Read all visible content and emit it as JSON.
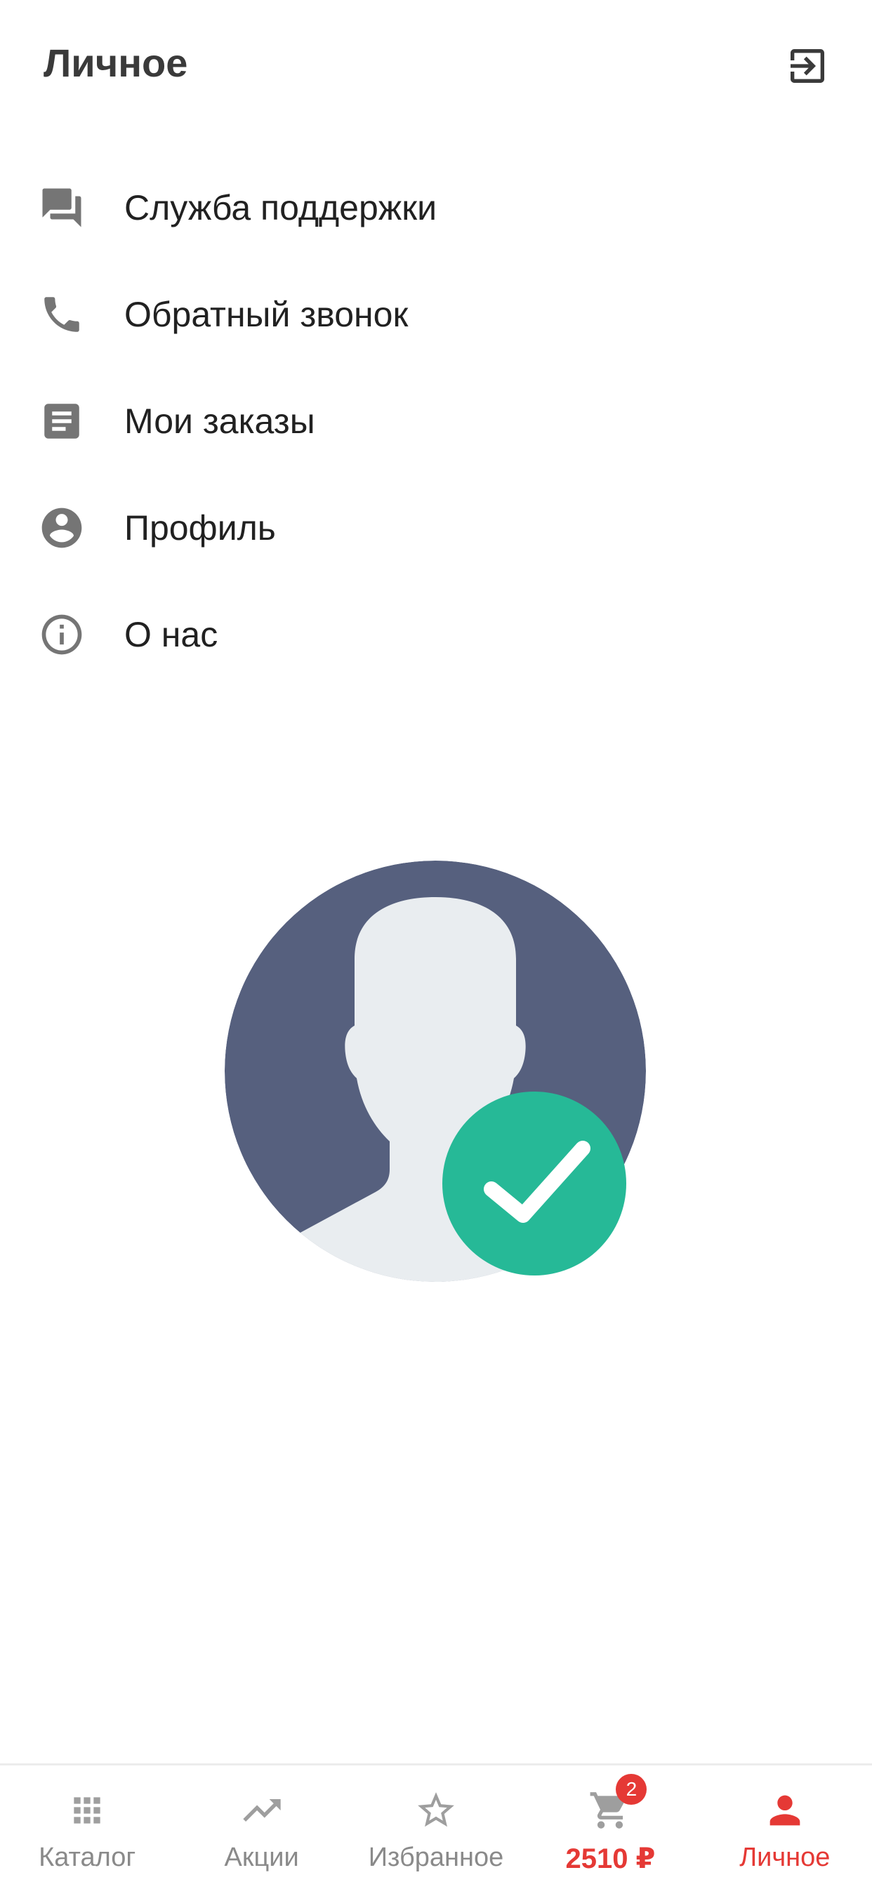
{
  "header": {
    "title": "Личное",
    "logout_icon": "logout-icon"
  },
  "menu": {
    "items": [
      {
        "label": "Служба поддержки",
        "icon": "chat-icon"
      },
      {
        "label": "Обратный звонок",
        "icon": "phone-icon"
      },
      {
        "label": "Мои заказы",
        "icon": "orders-icon"
      },
      {
        "label": "Профиль",
        "icon": "account-icon"
      },
      {
        "label": "О нас",
        "icon": "info-icon"
      }
    ]
  },
  "illustration": {
    "icon": "verified-user-avatar-illustration",
    "colors": {
      "circle": "#56607e",
      "silhouette": "#e9edf0",
      "check_circle": "#26b997"
    }
  },
  "bottom_nav": {
    "items": [
      {
        "label": "Каталог",
        "icon": "grid-icon"
      },
      {
        "label": "Акции",
        "icon": "trending-up-icon"
      },
      {
        "label": "Избранное",
        "icon": "star-outline-icon"
      },
      {
        "label": "2510 ₽",
        "icon": "cart-icon",
        "badge": "2"
      },
      {
        "label": "Личное",
        "icon": "person-icon",
        "active": true
      }
    ]
  },
  "colors": {
    "accent": "#e53935",
    "icon_gray": "#757575",
    "nav_inactive": "#8a8a8a"
  }
}
